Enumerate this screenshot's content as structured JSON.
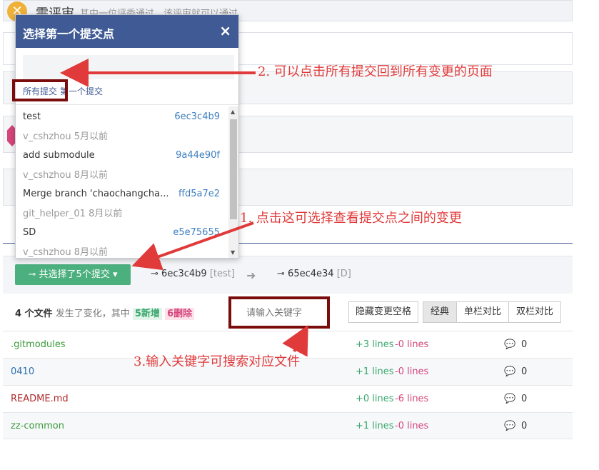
{
  "review": {
    "icon": "close-icon",
    "title": "需评审",
    "description": "其中一位评委通过，该评审就可以通过"
  },
  "popup": {
    "title": "选择第一个提交点",
    "close": "×",
    "search_placeholder": "",
    "tabs": [
      "所有提交",
      "第一个提交"
    ],
    "commits": [
      {
        "message": "test",
        "sha": "6ec3c4b9",
        "meta": "v_cshzhou 5月以前"
      },
      {
        "message": "add submodule",
        "sha": "9a44e90f",
        "meta": "v_cshzhou 8月以前"
      },
      {
        "message": "Merge branch 'chaochangcha...",
        "sha": "ffd5a7e2",
        "meta": "git_helper_01 8月以前"
      },
      {
        "message": "SD",
        "sha": "e5e75655",
        "meta": "v_cshzhou 8月以前"
      }
    ]
  },
  "annotations": {
    "a1": "1. 点击这可选择查看提交点之间的变更",
    "a2": "2. 可以点击所有提交回到所有变更的页面",
    "a3": "3.输入关键字可搜索对应文件"
  },
  "selector": {
    "button_label": "共选择了5个提交",
    "from_sha": "6ec3c4b9",
    "from_tag": "[test]",
    "to_sha": "65ec4e34",
    "to_tag": "[D]"
  },
  "summary": {
    "count": "4 个文件",
    "text": "发生了变化，其中",
    "added": "5新增",
    "deleted": "6删除",
    "search_placeholder": "请输入关键字",
    "hide_whitespace": "隐藏变更空格",
    "views": [
      "经典",
      "单栏对比",
      "双栏对比"
    ]
  },
  "files": [
    {
      "name": ".gitmodules",
      "added": "+3 lines",
      "deleted": "-0 lines",
      "comments": "0",
      "color": "#3a9b3a"
    },
    {
      "name": "0410",
      "added": "+1 lines",
      "deleted": "-0 lines",
      "comments": "0",
      "color": "#2e6fb0"
    },
    {
      "name": "README.md",
      "added": "+0 lines",
      "deleted": "-6 lines",
      "comments": "0",
      "color": "#b02a2a"
    },
    {
      "name": "zz-common",
      "added": "+1 lines",
      "deleted": "-0 lines",
      "comments": "0",
      "color": "#3a9b3a"
    }
  ]
}
